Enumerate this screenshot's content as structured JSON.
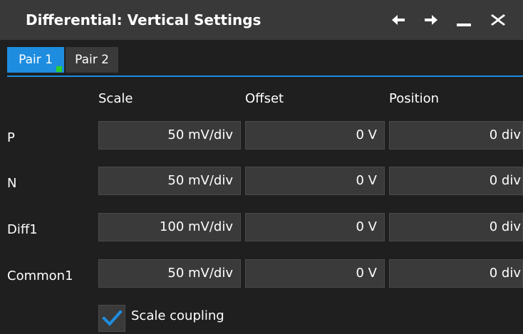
{
  "window": {
    "title": "Differential: Vertical Settings",
    "icons": [
      "arrow-left-icon",
      "arrow-right-icon",
      "minimize-icon",
      "close-icon"
    ]
  },
  "tabs": [
    {
      "label": "Pair 1",
      "active": true
    },
    {
      "label": "Pair 2",
      "active": false
    }
  ],
  "columns": {
    "scale": "Scale",
    "offset": "Offset",
    "position": "Position"
  },
  "rows": [
    {
      "label": "P",
      "scale": "50 mV/div",
      "offset": "0 V",
      "position": "0 div"
    },
    {
      "label": "N",
      "scale": "50 mV/div",
      "offset": "0 V",
      "position": "0 div"
    },
    {
      "label": "Diff1",
      "scale": "100 mV/div",
      "offset": "0 V",
      "position": "0 div"
    },
    {
      "label": "Common1",
      "scale": "50 mV/div",
      "offset": "0 V",
      "position": "0 div"
    }
  ],
  "scale_coupling": {
    "label": "Scale coupling",
    "checked": true
  },
  "colors": {
    "accent": "#1e8de0",
    "indicator": "#2bd02b",
    "field_bg": "#3a3a3a",
    "title_bg": "#393939"
  }
}
